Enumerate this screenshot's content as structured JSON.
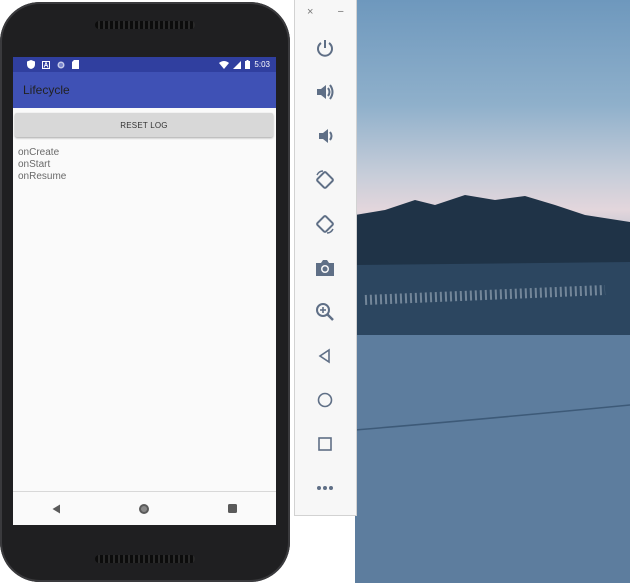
{
  "status_bar": {
    "time": "5:03",
    "left_icons": [
      "shield-icon",
      "a-icon",
      "circle-icon",
      "sd-card-icon"
    ],
    "right_icons": [
      "wifi-icon",
      "signal-icon",
      "battery-icon"
    ]
  },
  "app": {
    "title": "Lifecycle",
    "reset_button_label": "RESET LOG",
    "log_lines": [
      "onCreate",
      "onStart",
      "onResume"
    ]
  },
  "nav_bar": {
    "items": [
      "back-icon",
      "home-icon",
      "recents-icon"
    ]
  },
  "emulator_toolbar": {
    "window_controls": {
      "close": "×",
      "minimize": "−"
    },
    "buttons": [
      "power-icon",
      "volume-up-icon",
      "volume-down-icon",
      "rotate-left-icon",
      "rotate-right-icon",
      "camera-icon",
      "zoom-icon",
      "back-icon",
      "home-icon",
      "overview-icon",
      "more-icon"
    ]
  },
  "colors": {
    "primary": "#3f51b5",
    "primary_dark": "#303f9f",
    "toolbar_icon": "#5f6f86"
  }
}
